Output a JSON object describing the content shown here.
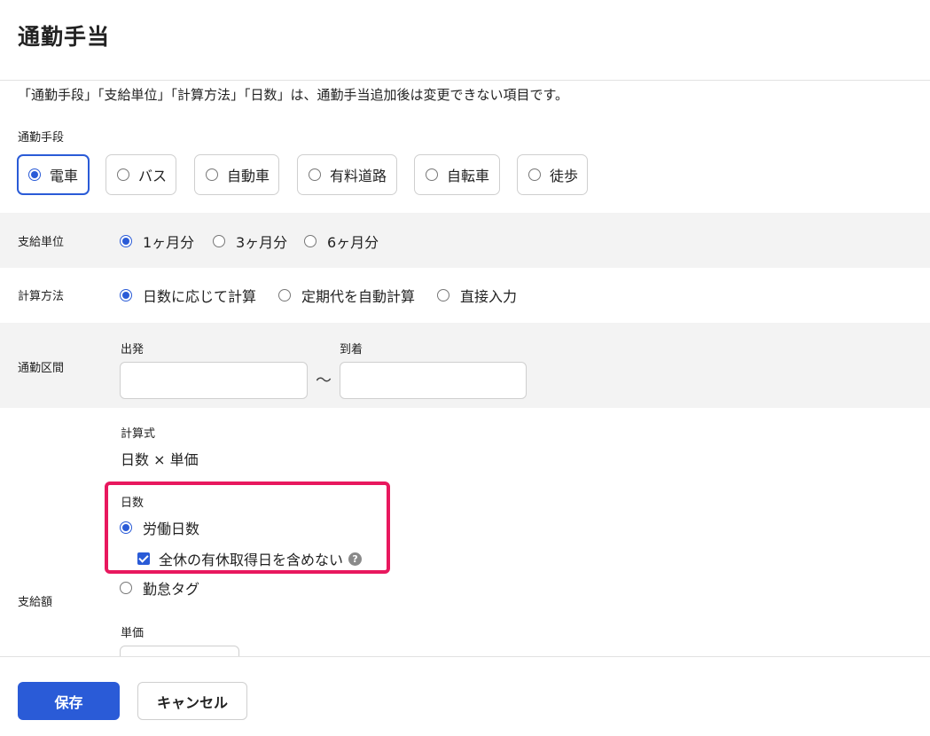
{
  "page": {
    "title": "通勤手当",
    "notice": "「通勤手段」「支給単位」「計算方法」「日数」は、通勤手当追加後は変更できない項目です。"
  },
  "commute_method": {
    "label": "通勤手段",
    "options": [
      {
        "label": "電車",
        "selected": true
      },
      {
        "label": "バス",
        "selected": false
      },
      {
        "label": "自動車",
        "selected": false
      },
      {
        "label": "有料道路",
        "selected": false
      },
      {
        "label": "自転車",
        "selected": false
      },
      {
        "label": "徒歩",
        "selected": false
      }
    ]
  },
  "payment_unit": {
    "label": "支給単位",
    "options": [
      {
        "label": "1ヶ月分",
        "selected": true
      },
      {
        "label": "3ヶ月分",
        "selected": false
      },
      {
        "label": "6ヶ月分",
        "selected": false
      }
    ]
  },
  "calc_method": {
    "label": "計算方法",
    "options": [
      {
        "label": "日数に応じて計算",
        "selected": true
      },
      {
        "label": "定期代を自動計算",
        "selected": false
      },
      {
        "label": "直接入力",
        "selected": false
      }
    ]
  },
  "commute_section": {
    "label": "通勤区間",
    "departure_label": "出発",
    "departure_value": "",
    "arrival_label": "到着",
    "arrival_value": "",
    "separator": "〜"
  },
  "amount": {
    "label": "支給額",
    "formula_label": "計算式",
    "formula": "日数 × 単価",
    "days_label": "日数",
    "days_options": [
      {
        "label": "労働日数",
        "selected": true
      },
      {
        "label": "勤怠タグ",
        "selected": false
      }
    ],
    "exclude_leave_label": "全休の有休取得日を含めない",
    "exclude_leave_checked": true,
    "help_icon": "?",
    "unit_price_label": "単価",
    "unit_price_value": ""
  },
  "actions": {
    "save": "保存",
    "cancel": "キャンセル"
  },
  "colors": {
    "accent": "#2a5bd7",
    "highlight": "#e8185e",
    "band": "#f3f3f3"
  }
}
